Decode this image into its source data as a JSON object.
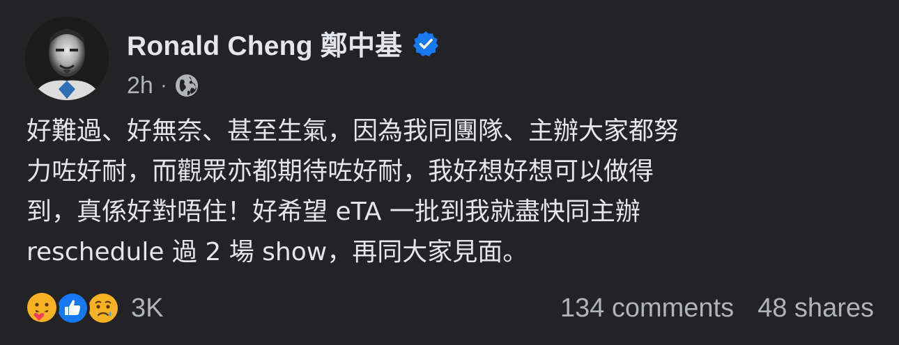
{
  "post": {
    "author": "Ronald Cheng 鄭中基",
    "verified_icon": "verified-badge-icon",
    "timestamp": "2h",
    "separator": "·",
    "audience_icon": "globe-icon",
    "text_lines": [
      "好難過、好無奈、甚至生氣，因為我同團隊、主辦大家都努",
      "力咗好耐，而觀眾亦都期待咗好耐，我好想好想可以做得",
      "到，真係好對唔住！好希望 eTA 一批到我就盡快同主辦",
      "reschedule 過 2 場 show，再同大家見面。"
    ]
  },
  "footer": {
    "reaction_icons": [
      "care-emoji-icon",
      "like-emoji-icon",
      "sad-emoji-icon"
    ],
    "reaction_count": "3K",
    "comments": "134 comments",
    "shares": "48 shares"
  },
  "colors": {
    "background": "#232325",
    "primary_text": "#e4e6eb",
    "secondary_text": "#b0b3b8",
    "verified_blue": "#1877f2"
  }
}
